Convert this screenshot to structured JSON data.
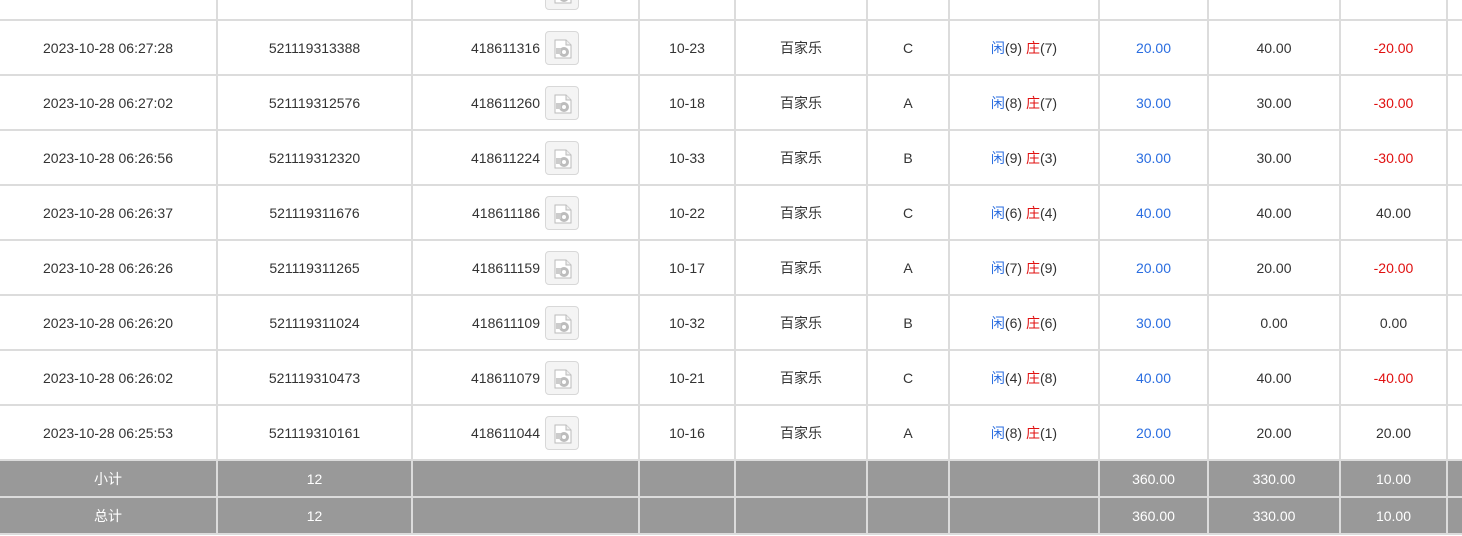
{
  "rows": [
    {
      "time": "",
      "order": "",
      "round": "",
      "table": "",
      "game": "",
      "seat": "",
      "result": {
        "p_label": "",
        "p_val": "",
        "b_label": "",
        "b_val": ""
      },
      "bet": "",
      "valid": "",
      "winloss": "",
      "winloss_neg": false,
      "partial": true
    },
    {
      "time": "2023-10-28 06:27:28",
      "order": "521119313388",
      "round": "418611316",
      "table": "10-23",
      "game": "百家乐",
      "seat": "C",
      "result": {
        "p_label": "闲",
        "p_val": "(9)",
        "b_label": "庄",
        "b_val": "(7)"
      },
      "bet": "20.00",
      "valid": "40.00",
      "winloss": "-20.00",
      "winloss_neg": true
    },
    {
      "time": "2023-10-28 06:27:02",
      "order": "521119312576",
      "round": "418611260",
      "table": "10-18",
      "game": "百家乐",
      "seat": "A",
      "result": {
        "p_label": "闲",
        "p_val": "(8)",
        "b_label": "庄",
        "b_val": "(7)"
      },
      "bet": "30.00",
      "valid": "30.00",
      "winloss": "-30.00",
      "winloss_neg": true
    },
    {
      "time": "2023-10-28 06:26:56",
      "order": "521119312320",
      "round": "418611224",
      "table": "10-33",
      "game": "百家乐",
      "seat": "B",
      "result": {
        "p_label": "闲",
        "p_val": "(9)",
        "b_label": "庄",
        "b_val": "(3)"
      },
      "bet": "30.00",
      "valid": "30.00",
      "winloss": "-30.00",
      "winloss_neg": true
    },
    {
      "time": "2023-10-28 06:26:37",
      "order": "521119311676",
      "round": "418611186",
      "table": "10-22",
      "game": "百家乐",
      "seat": "C",
      "result": {
        "p_label": "闲",
        "p_val": "(6)",
        "b_label": "庄",
        "b_val": "(4)"
      },
      "bet": "40.00",
      "valid": "40.00",
      "winloss": "40.00",
      "winloss_neg": false
    },
    {
      "time": "2023-10-28 06:26:26",
      "order": "521119311265",
      "round": "418611159",
      "table": "10-17",
      "game": "百家乐",
      "seat": "A",
      "result": {
        "p_label": "闲",
        "p_val": "(7)",
        "b_label": "庄",
        "b_val": "(9)"
      },
      "bet": "20.00",
      "valid": "20.00",
      "winloss": "-20.00",
      "winloss_neg": true
    },
    {
      "time": "2023-10-28 06:26:20",
      "order": "521119311024",
      "round": "418611109",
      "table": "10-32",
      "game": "百家乐",
      "seat": "B",
      "result": {
        "p_label": "闲",
        "p_val": "(6)",
        "b_label": "庄",
        "b_val": "(6)"
      },
      "bet": "30.00",
      "valid": "0.00",
      "winloss": "0.00",
      "winloss_neg": false
    },
    {
      "time": "2023-10-28 06:26:02",
      "order": "521119310473",
      "round": "418611079",
      "table": "10-21",
      "game": "百家乐",
      "seat": "C",
      "result": {
        "p_label": "闲",
        "p_val": "(4)",
        "b_label": "庄",
        "b_val": "(8)"
      },
      "bet": "40.00",
      "valid": "40.00",
      "winloss": "-40.00",
      "winloss_neg": true
    },
    {
      "time": "2023-10-28 06:25:53",
      "order": "521119310161",
      "round": "418611044",
      "table": "10-16",
      "game": "百家乐",
      "seat": "A",
      "result": {
        "p_label": "闲",
        "p_val": "(8)",
        "b_label": "庄",
        "b_val": "(1)"
      },
      "bet": "20.00",
      "valid": "20.00",
      "winloss": "20.00",
      "winloss_neg": false
    }
  ],
  "subtotal": {
    "label": "小计",
    "count": "12",
    "bet": "360.00",
    "valid": "330.00",
    "winloss": "10.00"
  },
  "total": {
    "label": "总计",
    "count": "12",
    "bet": "360.00",
    "valid": "330.00",
    "winloss": "10.00"
  },
  "colors": {
    "blue": "#2a6de0",
    "red": "#e01010",
    "summary_bg": "#999999",
    "border": "#dcdcdc"
  },
  "icons": {
    "replay": "video-replay-icon"
  }
}
